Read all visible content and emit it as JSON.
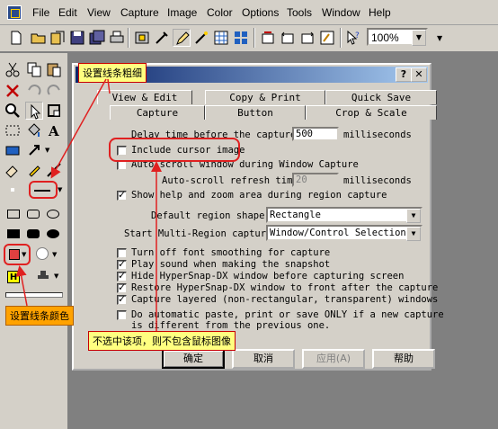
{
  "menu": [
    "File",
    "Edit",
    "View",
    "Capture",
    "Image",
    "Color",
    "Options",
    "Tools",
    "Window",
    "Help"
  ],
  "toolbar": {
    "icons": [
      "new-icon",
      "open-icon",
      "save-icon",
      "save-as-icon",
      "print-icon",
      "capture-icon",
      "tools-icon",
      "edit-icon",
      "text-icon",
      "copy-icon",
      "paste-icon",
      "undo-icon",
      "redo-icon",
      "crop-icon",
      "find-icon",
      "help-icon"
    ],
    "zoom": "100%"
  },
  "dialog": {
    "tabs_back": [
      "View & Edit",
      "Copy & Print",
      "Quick Save"
    ],
    "tabs_front": [
      "Capture",
      "Button",
      "Crop & Scale"
    ],
    "delay_label": "Delay time before the capture:",
    "delay_value": "500",
    "delay_unit": "milliseconds",
    "include_cursor": "Include cursor image",
    "autoscroll": "Auto-scroll window during Window Capture",
    "autoscroll_refresh": "Auto-scroll refresh time:",
    "autoscroll_value": "20",
    "autoscroll_unit": "milliseconds",
    "show_help": "Show help and zoom area during region capture",
    "default_region_label": "Default region shape:",
    "default_region_value": "Rectangle",
    "start_multi_label": "Start Multi-Region capture",
    "start_multi_value": "Window/Control Selection",
    "opt1": "Turn off font smoothing for capture",
    "opt2": "Play sound when making the snapshot",
    "opt3": "Hide HyperSnap-DX window before capturing screen",
    "opt4": "Restore HyperSnap-DX window to front after the capture",
    "opt5": "Capture layered (non-rectangular, transparent) windows",
    "opt6_line1": "Do automatic paste, print or save ONLY if a new capture",
    "opt6_line2": "is different from the previous one.",
    "checks": {
      "include_cursor": false,
      "autoscroll": false,
      "show_help": true,
      "opt1": false,
      "opt2": true,
      "opt3": true,
      "opt4": true,
      "opt5": true,
      "opt6": false
    },
    "buttons": {
      "ok": "确定",
      "cancel": "取消",
      "apply": "应用(A)",
      "help": "帮助"
    }
  },
  "annotations": {
    "line_thickness": "设置线条粗细",
    "line_color": "设置线条颜色",
    "cursor_note": "不选中该项，则不包含鼠标图像"
  },
  "colors": {
    "dialog_bg": "#d4d0c8",
    "title_start": "#0a246a",
    "title_end": "#a6caf0",
    "annotation_red": "#e02020",
    "desktop": "#808080"
  }
}
